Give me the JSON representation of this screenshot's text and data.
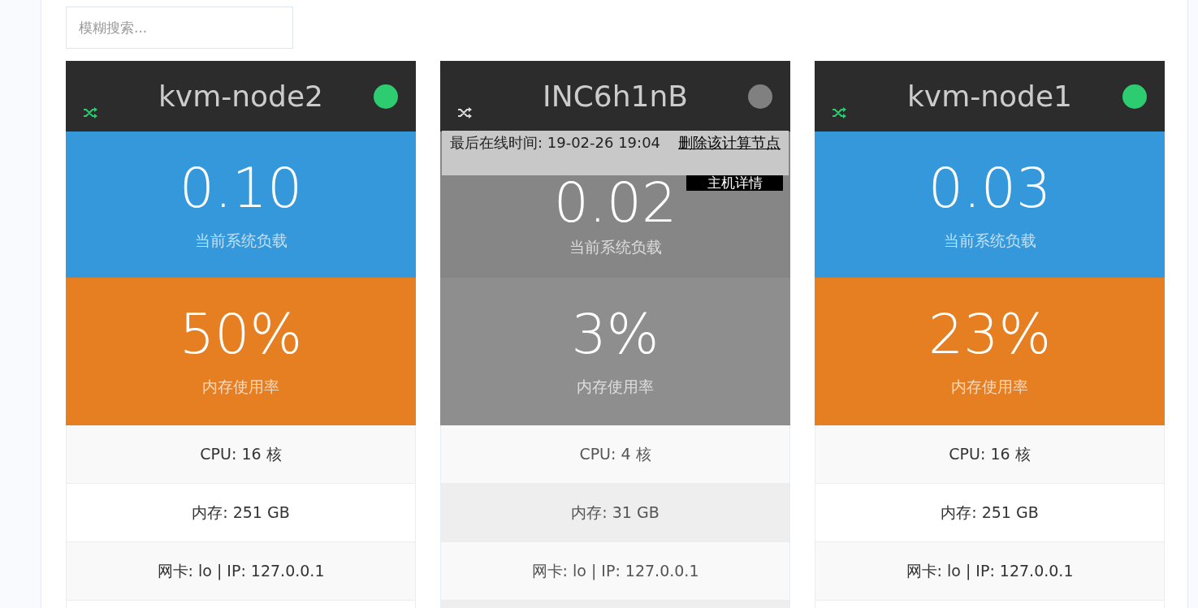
{
  "search": {
    "placeholder": "模糊搜索..."
  },
  "nodes": [
    {
      "name": "kvm-node2",
      "online": true,
      "load": "0.10",
      "load_label": "当前系统负载",
      "memory": "50%",
      "memory_label": "内存使用率",
      "rows": [
        "CPU: 16 核",
        "内存: 251 GB",
        "网卡: lo | IP: 127.0.0.1"
      ]
    },
    {
      "name": "INC6h1nB",
      "online": false,
      "load": "0.02",
      "load_label": "当前系统负载",
      "memory": "3%",
      "memory_label": "内存使用率",
      "rows": [
        "CPU: 4 核",
        "内存: 31 GB",
        "网卡: lo | IP: 127.0.0.1"
      ],
      "last_online": "最后在线时间: 19-02-26 19:04",
      "delete_link": "删除该计算节点",
      "details_button": "主机详情"
    },
    {
      "name": "kvm-node1",
      "online": true,
      "load": "0.03",
      "load_label": "当前系统负载",
      "memory": "23%",
      "memory_label": "内存使用率",
      "rows": [
        "CPU: 16 核",
        "内存: 251 GB",
        "网卡: lo | IP: 127.0.0.1"
      ]
    }
  ]
}
